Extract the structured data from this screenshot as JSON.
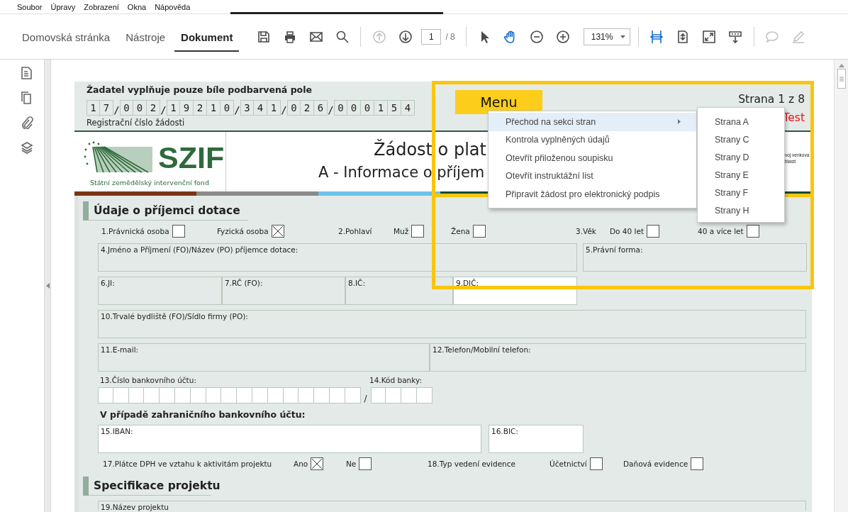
{
  "menubar": [
    "Soubor",
    "Úpravy",
    "Zobrazení",
    "Okna",
    "Nápověda"
  ],
  "toolbar": {
    "tabs": [
      {
        "label": "Domovská stránka",
        "selected": false
      },
      {
        "label": "Nástroje",
        "selected": false
      },
      {
        "label": "Dokument",
        "selected": true
      }
    ],
    "tool_groups": [
      [
        {
          "kind": "save",
          "disabled": false,
          "selected": false
        },
        {
          "kind": "print",
          "disabled": false,
          "selected": false
        },
        {
          "kind": "mail",
          "disabled": false,
          "selected": false
        },
        {
          "kind": "search",
          "disabled": false,
          "selected": false
        }
      ],
      [
        {
          "kind": "prev-page",
          "disabled": true,
          "selected": false
        },
        {
          "kind": "next-page",
          "disabled": false,
          "selected": false
        },
        {
          "kind": "page-field",
          "value": "1",
          "total": "/ 8"
        }
      ],
      [
        {
          "kind": "pointer",
          "disabled": false,
          "selected": false
        },
        {
          "kind": "hand",
          "disabled": false,
          "selected": true
        },
        {
          "kind": "zoom-out",
          "disabled": false,
          "selected": false
        },
        {
          "kind": "zoom-in",
          "disabled": false,
          "selected": false
        },
        {
          "kind": "zoom-field",
          "value": "131%"
        }
      ],
      [
        {
          "kind": "fit-width",
          "disabled": false,
          "selected": true
        },
        {
          "kind": "fit-page",
          "disabled": false,
          "selected": false
        },
        {
          "kind": "fullscreen",
          "disabled": false,
          "selected": false
        },
        {
          "kind": "scroll-mode",
          "disabled": false,
          "selected": false
        }
      ],
      [
        {
          "kind": "comment",
          "disabled": true,
          "selected": false
        },
        {
          "kind": "pen",
          "disabled": true,
          "selected": false
        }
      ]
    ]
  },
  "form": {
    "instruction": "Žadatel vyplňuje pouze bíle podbarvená pole",
    "registration_groups": [
      [
        "1",
        "7"
      ],
      [
        "0",
        "0",
        "2"
      ],
      [
        "1",
        "9",
        "2",
        "1",
        "0"
      ],
      [
        "3",
        "4",
        "1"
      ],
      [
        "0",
        "2",
        "6"
      ],
      [
        "0",
        "0",
        "0",
        "1",
        "5",
        "4"
      ]
    ],
    "registration_separator": "/",
    "registration_label": "Registrační číslo žádosti",
    "menu_button": "Menu",
    "page_label": "Strana 1 z 8",
    "mode_label": "Test",
    "logo": {
      "name": "SZIF",
      "subtitle": "Státní zemědělský intervenční fond"
    },
    "title": "Žádost o plat",
    "subtitle": "A - Informace o příjem",
    "side_note": [
      "voj venkova",
      "blastí"
    ],
    "sections": [
      {
        "title": "Údaje o příjemci dotace",
        "rows": [
          {
            "kind": "checks",
            "items": [
              {
                "kind": "checkbox",
                "label": "1.Právnická osoba",
                "checked": false
              },
              {
                "kind": "checkbox",
                "label": "Fyzická osoba",
                "checked": true
              },
              {
                "kind": "label",
                "label": "2.Pohlaví"
              },
              {
                "kind": "checkbox",
                "label": "Muž",
                "checked": false
              },
              {
                "kind": "checkbox",
                "label": "Žena",
                "checked": false
              },
              {
                "kind": "label",
                "label": "3.Věk"
              },
              {
                "kind": "checkbox",
                "label": "Do 40 let",
                "checked": false
              },
              {
                "kind": "checkbox",
                "label": "40 a více let",
                "checked": false
              }
            ]
          },
          {
            "kind": "fields",
            "fields": [
              {
                "label": "4.Jméno a Příjmení (FO)/Název (PO) příjemce dotace:",
                "editable": false
              },
              {
                "label": "5.Právní forma:",
                "editable": false
              }
            ]
          },
          {
            "kind": "fields",
            "fields": [
              {
                "label": "6.JI:",
                "editable": false
              },
              {
                "label": "7.RČ (FO):",
                "editable": false
              },
              {
                "label": "8.IČ:",
                "editable": false
              },
              {
                "label": "9.DIČ:",
                "editable": true
              }
            ]
          },
          {
            "kind": "fields",
            "fields": [
              {
                "label": "10.Trvalé bydliště (FO)/Sídlo firmy (PO):",
                "editable": false
              }
            ]
          },
          {
            "kind": "fields",
            "fields": [
              {
                "label": "11.E-mail:",
                "editable": false
              },
              {
                "label": "12.Telefon/Mobilní telefon:",
                "editable": false
              }
            ]
          },
          {
            "kind": "bank",
            "account_label": "13.Číslo bankovního účtu:",
            "separator": "/",
            "bank_code_label": "14.Kód banky:"
          },
          {
            "kind": "heading",
            "text": "V případě zahraničního bankovního účtu:"
          },
          {
            "kind": "fields",
            "fields": [
              {
                "label": "15.IBAN:",
                "editable": true
              },
              {
                "label": "16.BIC:",
                "editable": true
              }
            ]
          },
          {
            "kind": "checks",
            "items": [
              {
                "kind": "label",
                "label": "17.Plátce DPH ve vztahu k aktivitám projektu"
              },
              {
                "kind": "checkbox",
                "label": "Ano",
                "checked": true
              },
              {
                "kind": "checkbox",
                "label": "Ne",
                "checked": false
              },
              {
                "kind": "label",
                "label": "18.Typ vedení evidence"
              },
              {
                "kind": "checkbox",
                "label": "Účetnictví",
                "checked": false
              },
              {
                "kind": "checkbox",
                "label": "Daňová evidence",
                "checked": false
              }
            ]
          }
        ]
      },
      {
        "title": "Specifikace projektu",
        "rows": [
          {
            "kind": "fields",
            "fields": [
              {
                "label": "19.Název projektu",
                "editable": false
              }
            ]
          }
        ]
      }
    ]
  },
  "context_menu": {
    "items": [
      {
        "label": "Přechod na sekci stran",
        "kind": "submenu",
        "selected": true
      },
      {
        "label": "Kontrola vyplněných údajů",
        "kind": "action",
        "selected": false
      },
      {
        "label": "Otevřít přiloženou soupisku",
        "kind": "action",
        "selected": false
      },
      {
        "label": "Otevřít instruktážní list",
        "kind": "action",
        "selected": false
      },
      {
        "label": "Připravit žádost pro elektronický podpis",
        "kind": "action",
        "selected": false
      }
    ]
  },
  "submenu": {
    "items": [
      "Strana A",
      "Strany C",
      "Strany D",
      "Strany E",
      "Strany F",
      "Strany H"
    ]
  }
}
